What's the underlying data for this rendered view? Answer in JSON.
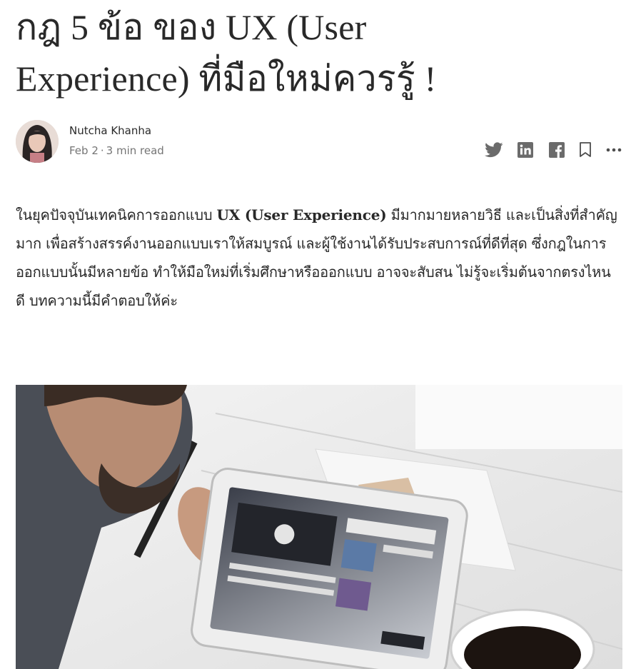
{
  "article": {
    "title_line1": "กฎ 5 ข้อ ของ UX (User",
    "title_line2": "Experience) ที่มือใหม่ควรรู้ !",
    "author": {
      "name": "Nutcha Khanha",
      "date": "Feb 2",
      "separator": "·",
      "read_time": "3 min read"
    },
    "actions": [
      "twitter-icon",
      "linkedin-icon",
      "facebook-icon",
      "bookmark-icon",
      "more-icon"
    ],
    "body": {
      "lead": "ในยุคปัจจุบันเทคนิคการออกแบบ ",
      "bold": "UX (User Experience)",
      "rest": " มีมากมายหลายวิธี และเป็นสิ่งที่สำคัญมาก เพื่อสร้างสรรค์งานออกแบบเราให้สมบูรณ์ และผู้ใช้งานได้รับประสบการณ์ที่ดีที่สุด ซึ่งกฎในการออกแบบนั้นมีหลายข้อ ทำให้มือใหม่ที่เริ่มศึกษาหรือออกแบบ อาจจะสับสน ไม่รู้จะเริ่มต้นจากตรงไหนดี บทความนี้มีคำตอบให้ค่ะ"
    },
    "colors": {
      "text": "#292929",
      "muted": "#757575",
      "icon": "#6b6b6b"
    }
  }
}
